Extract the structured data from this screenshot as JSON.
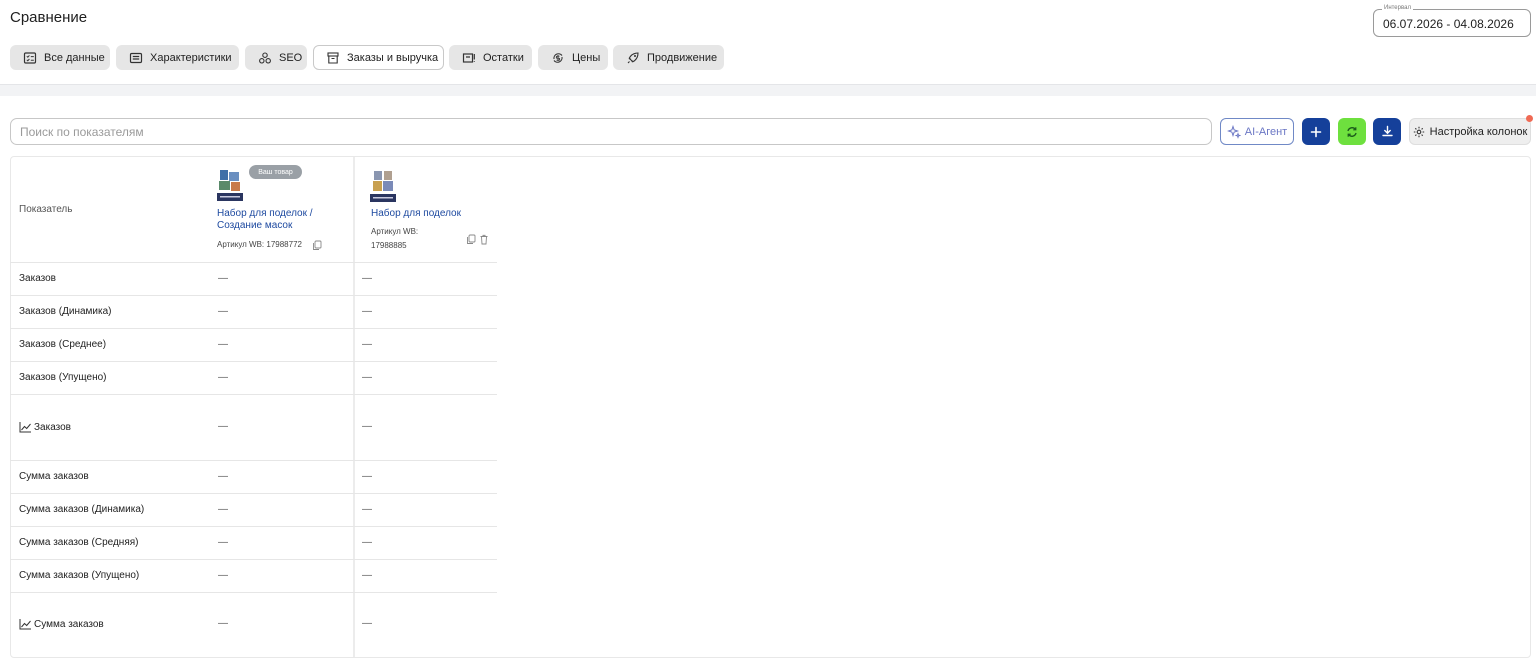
{
  "page": {
    "title": "Сравнение"
  },
  "interval": {
    "label": "Интервал",
    "value": "06.07.2026 - 04.08.2026"
  },
  "tabs": [
    {
      "label": "Все данные",
      "icon": "list-icon",
      "active": false
    },
    {
      "label": "Характеристики",
      "icon": "card-icon",
      "active": false
    },
    {
      "label": "SEO",
      "icon": "seo-icon",
      "active": false
    },
    {
      "label": "Заказы и выручка",
      "icon": "box-icon",
      "active": true
    },
    {
      "label": "Остатки",
      "icon": "stock-icon",
      "active": false
    },
    {
      "label": "Цены",
      "icon": "coin-icon",
      "active": false
    },
    {
      "label": "Продвижение",
      "icon": "rocket-icon",
      "active": false
    }
  ],
  "toolbar": {
    "search_placeholder": "Поиск по показателям",
    "ai_label": "AI-Агент",
    "settings_label": "Настройка колонок",
    "colors": {
      "primary": "#15409a",
      "refresh": "#6ee03e",
      "notification": "#f06a54"
    }
  },
  "table": {
    "header_label": "Показатель",
    "products": [
      {
        "badge": "Ваш товар",
        "name_line1": "Набор для поделок /",
        "name_line2": "Создание масок",
        "article": "Артикул WB: 17988772"
      },
      {
        "badge": "",
        "name_line1": "Набор для поделок",
        "name_line2": "",
        "article_line1": "Артикул WB:",
        "article_line2": "17988885"
      }
    ],
    "rows": [
      {
        "label": "Заказов",
        "chart": false,
        "v1": "—",
        "v2": "—"
      },
      {
        "label": "Заказов (Динамика)",
        "chart": false,
        "v1": "—",
        "v2": "—"
      },
      {
        "label": "Заказов (Среднее)",
        "chart": false,
        "v1": "—",
        "v2": "—"
      },
      {
        "label": "Заказов (Упущено)",
        "chart": false,
        "v1": "—",
        "v2": "—"
      },
      {
        "label": "Заказов",
        "chart": true,
        "v1": "—",
        "v2": "—"
      },
      {
        "label": "Сумма заказов",
        "chart": false,
        "v1": "—",
        "v2": "—"
      },
      {
        "label": "Сумма заказов (Динамика)",
        "chart": false,
        "v1": "—",
        "v2": "—"
      },
      {
        "label": "Сумма заказов (Средняя)",
        "chart": false,
        "v1": "—",
        "v2": "—"
      },
      {
        "label": "Сумма заказов (Упущено)",
        "chart": false,
        "v1": "—",
        "v2": "—"
      },
      {
        "label": "Сумма заказов",
        "chart": true,
        "v1": "—",
        "v2": "—"
      }
    ]
  }
}
